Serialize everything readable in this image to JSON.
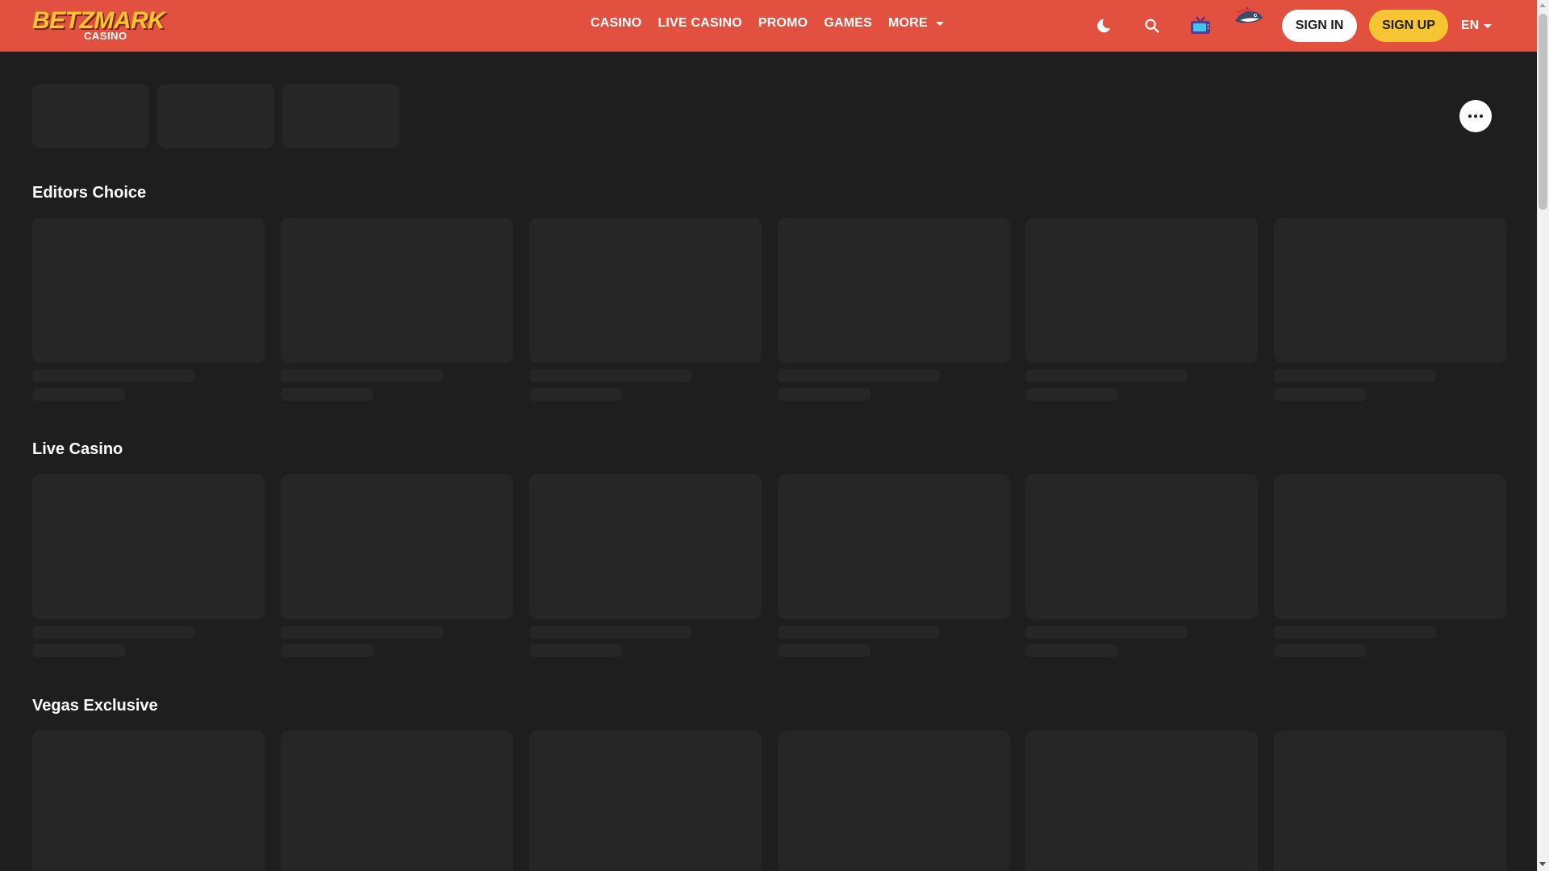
{
  "brand": {
    "logo_main": "BETZMARK",
    "logo_sub": "CASINO",
    "accent": "#e2513f",
    "yellow": "#f7c531"
  },
  "nav": [
    {
      "label": "CASINO"
    },
    {
      "label": "LIVE CASINO"
    },
    {
      "label": "PROMO"
    },
    {
      "label": "GAMES"
    },
    {
      "label": "MORE"
    }
  ],
  "header_icons": [
    "moon-icon",
    "search-icon",
    "tv-icon",
    "shark-mascot-icon"
  ],
  "auth": {
    "signin_label": "SIGN IN",
    "signup_label": "SIGN UP"
  },
  "language": {
    "selected": "EN"
  },
  "sections": [
    {
      "title": "Editors Choice"
    },
    {
      "title": "Live Casino"
    },
    {
      "title": "Vegas Exclusive"
    }
  ],
  "loading_state": "skeleton",
  "colors": {
    "background": "#1e1e1e",
    "skeleton": "#262626"
  }
}
